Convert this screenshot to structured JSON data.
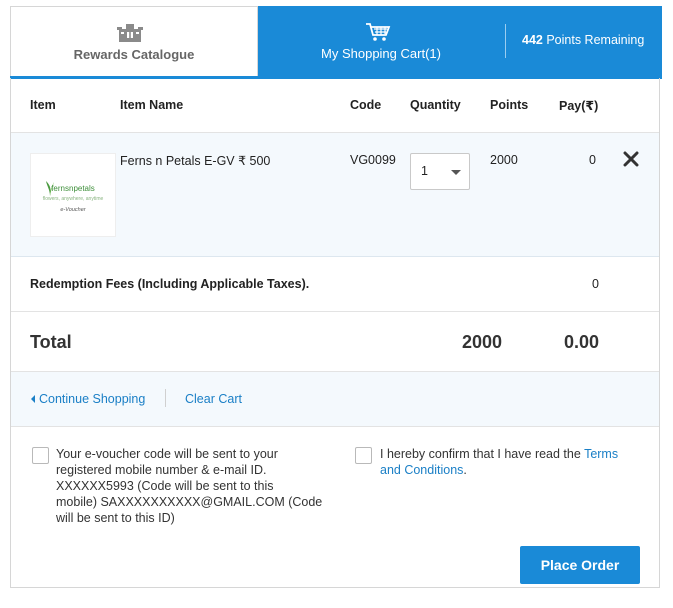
{
  "tabs": {
    "catalogue_label": "Rewards Catalogue",
    "cart_label": "My Shopping Cart(1)",
    "points_value": "442",
    "points_text": "Points Remaining"
  },
  "table": {
    "headers": {
      "item": "Item",
      "item_name": "Item Name",
      "code": "Code",
      "quantity": "Quantity",
      "points": "Points",
      "pay": "Pay(₹)"
    },
    "rows": [
      {
        "logo_text": "fernsnpetals",
        "logo_tagline": "flowers, anywhere, anytime",
        "logo_sub": "e-Voucher",
        "name": "Ferns n Petals E-GV ₹ 500",
        "code": "VG0099",
        "quantity": "1",
        "points": "2000",
        "pay": "0"
      }
    ],
    "fees_label": "Redemption Fees (Including Applicable Taxes).",
    "fees_value": "0",
    "total_label": "Total",
    "total_points": "2000",
    "total_pay": "0.00"
  },
  "actions": {
    "continue_label": "Continue Shopping",
    "clear_label": "Clear Cart"
  },
  "consent": {
    "voucher_line1": "Your e-voucher code will be sent to your",
    "voucher_line2": "registered mobile number & e-mail ID.",
    "voucher_line3": "XXXXXX5993 (Code will be sent to this",
    "voucher_line4": "mobile) SAXXXXXXXXXX@GMAIL.COM (Code",
    "voucher_line5": "will be sent to this ID)",
    "terms_prefix": "I hereby confirm that I have read the",
    "terms_link_1": "Terms",
    "terms_link_2": "and Conditions",
    "terms_suffix": "."
  },
  "place_order_label": "Place Order",
  "colors": {
    "accent": "#1a8ad7",
    "link": "#1a7fc6",
    "row_tint": "#f4f9fd"
  }
}
